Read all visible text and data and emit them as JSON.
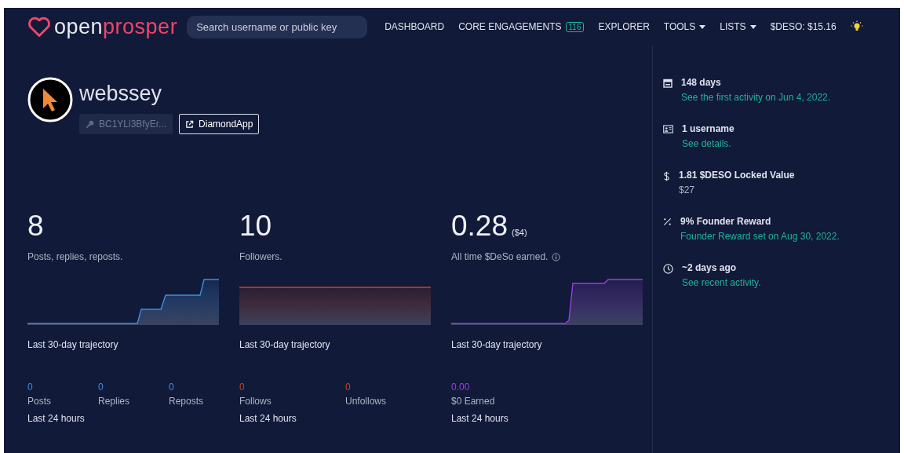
{
  "brand": {
    "part_1": "open",
    "part_2": "prosper"
  },
  "search": {
    "placeholder": "Search username or public key"
  },
  "nav": [
    {
      "kind": "link",
      "label": "DASHBOARD"
    },
    {
      "kind": "link",
      "label": "CORE ENGAGEMENTS",
      "badge": "116"
    },
    {
      "kind": "link",
      "label": "EXPLORER"
    },
    {
      "kind": "dropdown",
      "label": "TOOLS"
    },
    {
      "kind": "dropdown",
      "label": "LISTS"
    },
    {
      "kind": "text",
      "label": "$DESO: $15.16"
    },
    {
      "kind": "theme"
    }
  ],
  "profile": {
    "username": "webssey",
    "public_key": "BC1YLi3BfyEr...",
    "link": "DiamondApp"
  },
  "stats": [
    {
      "value": "8",
      "description": "Posts, replies, reposts.",
      "color": "#3b8ee6",
      "kind": "steps",
      "trajectory_label": "Last 30-day trajectory",
      "counts": [
        {
          "value": "0",
          "label": "Posts"
        },
        {
          "value": "0",
          "label": "Replies"
        },
        {
          "value": "0",
          "label": "Reposts"
        }
      ],
      "period": "Last 24 hours"
    },
    {
      "value": "10",
      "description": "Followers.",
      "color": "#d0401f",
      "kind": "flat",
      "trajectory_label": "Last 30-day trajectory",
      "counts": [
        {
          "value": "0",
          "label": "Follows"
        },
        {
          "value": "0",
          "label": "Unfollows"
        }
      ],
      "period": "Last 24 hours"
    },
    {
      "value": "0.28",
      "sub": "($4)",
      "description": "All time $DeSo earned.",
      "info": true,
      "color": "#9b3de8",
      "kind": "jump",
      "trajectory_label": "Last 30-day trajectory",
      "counts": [
        {
          "value": "0.00",
          "label": "$0 Earned"
        }
      ],
      "period": "Last 24 hours"
    }
  ],
  "facts": [
    {
      "kind": "calendar",
      "title": "148 days",
      "link": "See the first activity on Jun 4, 2022."
    },
    {
      "kind": "id-card",
      "title": "1 username",
      "link": "See details."
    },
    {
      "kind": "dollar",
      "title": "1.81 $DESO Locked Value",
      "note": "$27"
    },
    {
      "kind": "percent",
      "title": "9% Founder Reward",
      "link": "Founder Reward set on Aug 30, 2022."
    },
    {
      "kind": "clock",
      "title": "~2 days ago",
      "link": "See recent activity."
    }
  ]
}
